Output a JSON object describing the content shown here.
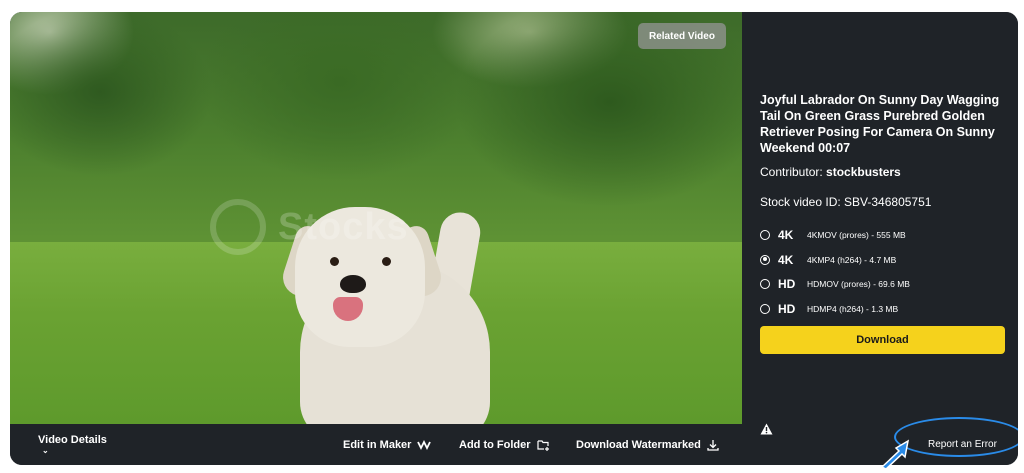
{
  "video": {
    "related_label": "Related Video",
    "watermark_text": "Stocks"
  },
  "bottombar": {
    "details_label": "Video Details",
    "details_chevron": "⌄",
    "maker_label": "Edit in Maker",
    "folder_label": "Add to Folder",
    "watermark_label": "Download Watermarked"
  },
  "sidebar": {
    "title": "Joyful Labrador On Sunny Day Wagging Tail On Green Grass Purebred Golden Retriever Posing For Camera On Sunny Weekend 00:07",
    "contributor_prefix": "Contributor: ",
    "contributor_name": "stockbusters",
    "stock_id": "Stock video ID: SBV-346805751",
    "options": [
      {
        "res": "4K",
        "format": "4KMOV (prores) - 555 MB",
        "selected": false
      },
      {
        "res": "4K",
        "format": "4KMP4 (h264) - 4.7 MB",
        "selected": true
      },
      {
        "res": "HD",
        "format": "HDMOV (prores) - 69.6 MB",
        "selected": false
      },
      {
        "res": "HD",
        "format": "HDMP4 (h264) - 1.3 MB",
        "selected": false
      }
    ],
    "download_label": "Download",
    "report_label": "Report an Error"
  },
  "colors": {
    "panel": "#1f2328",
    "accent": "#f5d21c",
    "highlight": "#2a8be8"
  }
}
